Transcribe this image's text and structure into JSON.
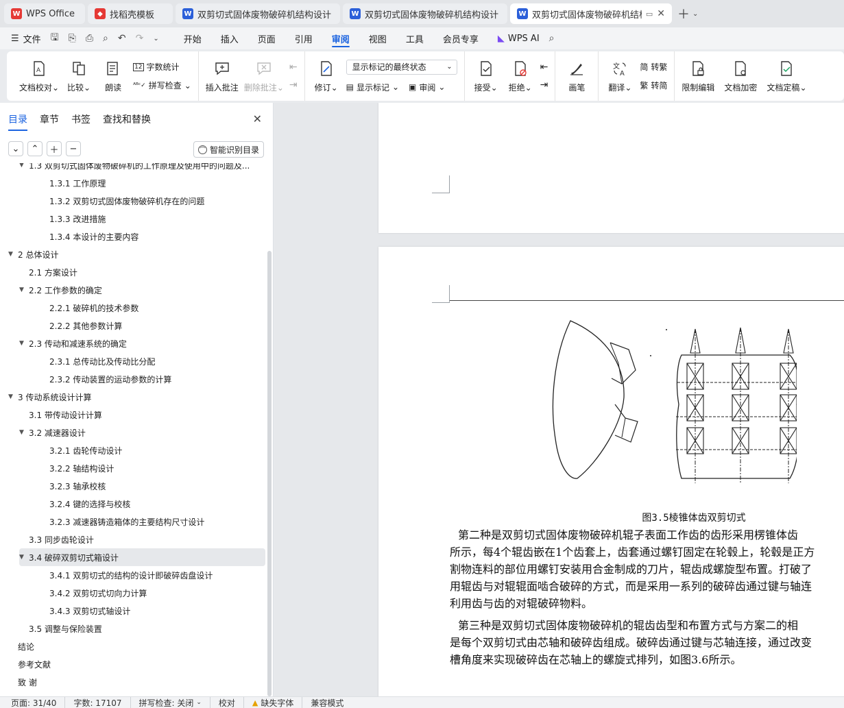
{
  "tabs": [
    {
      "label": "WPS Office",
      "icon": "wps-logo-icon",
      "color": "#e53935"
    },
    {
      "label": "找稻壳模板",
      "icon": "docer-icon",
      "color": "#e53935"
    },
    {
      "label": "双剪切式固体废物破碎机结构设计 任务",
      "icon": "word-doc-icon",
      "color": "#2b5fd9"
    },
    {
      "label": "双剪切式固体废物破碎机结构设计 开题",
      "icon": "word-doc-icon",
      "color": "#2b5fd9"
    },
    {
      "label": "双剪切式固体废物破碎机结构设",
      "icon": "word-doc-icon",
      "color": "#2b5fd9"
    }
  ],
  "menubar": {
    "file_label": "文件",
    "tabs": [
      "开始",
      "插入",
      "页面",
      "引用",
      "审阅",
      "视图",
      "工具",
      "会员专享"
    ],
    "active_tab": "审阅",
    "ai_label": "WPS AI"
  },
  "ribbon": {
    "proofread": "文档校对",
    "compare": "比较",
    "read_aloud": "朗读",
    "word_count": "字数统计",
    "spell_check": "拼写检查",
    "insert_comment": "插入批注",
    "delete_comment": "删除批注",
    "revise": "修订",
    "markup_state": "显示标记的最终状态",
    "show_markup": "显示标记",
    "review": "审阅",
    "accept": "接受",
    "reject": "拒绝",
    "pen": "画笔",
    "translate": "翻译",
    "to_traditional": "转繁",
    "to_simplified": "转简",
    "restrict_edit": "限制编辑",
    "encrypt": "文档加密",
    "finalize": "文档定稿"
  },
  "sidebar": {
    "tabs": [
      "目录",
      "章节",
      "书签",
      "查找和替换"
    ],
    "active_tab": "目录",
    "smart_toc": "智能识别目录",
    "toc": [
      {
        "level": 2,
        "caret": true,
        "text": "1.3 双剪切式固体废物破碎机的工作原理及使用中的问题及..."
      },
      {
        "level": 3,
        "caret": false,
        "text": "1.3.1 工作原理"
      },
      {
        "level": 3,
        "caret": false,
        "text": "1.3.2 双剪切式固体废物破碎机存在的问题"
      },
      {
        "level": 3,
        "caret": false,
        "text": "1.3.3 改进措施"
      },
      {
        "level": 3,
        "caret": false,
        "text": "1.3.4 本设计的主要内容"
      },
      {
        "level": 1,
        "caret": true,
        "text": "2  总体设计"
      },
      {
        "level": 2,
        "caret": false,
        "text": "2.1 方案设计"
      },
      {
        "level": 2,
        "caret": true,
        "text": "2.2 工作参数的确定"
      },
      {
        "level": 3,
        "caret": false,
        "text": "2.2.1 破碎机的技术参数"
      },
      {
        "level": 3,
        "caret": false,
        "text": "2.2.2 其他参数计算"
      },
      {
        "level": 2,
        "caret": true,
        "text": "2.3 传动和减速系统的确定"
      },
      {
        "level": 3,
        "caret": false,
        "text": "2.3.1 总传动比及传动比分配"
      },
      {
        "level": 3,
        "caret": false,
        "text": "2.3.2 传动装置的运动参数的计算"
      },
      {
        "level": 1,
        "caret": true,
        "text": "3  传动系统设计计算"
      },
      {
        "level": 2,
        "caret": false,
        "text": "3.1  带传动设计计算"
      },
      {
        "level": 2,
        "caret": true,
        "text": "3.2 减速器设计"
      },
      {
        "level": 3,
        "caret": false,
        "text": "3.2.1 齿轮传动设计"
      },
      {
        "level": 3,
        "caret": false,
        "text": "3.2.2 轴结构设计"
      },
      {
        "level": 3,
        "caret": false,
        "text": "3.2.3 轴承校核"
      },
      {
        "level": 3,
        "caret": false,
        "text": "3.2.4 键的选择与校核"
      },
      {
        "level": 3,
        "caret": false,
        "text": "3.2.3 减速器铸造箱体的主要结构尺寸设计"
      },
      {
        "level": 2,
        "caret": false,
        "text": "3.3 同步齿轮设计"
      },
      {
        "level": 2,
        "caret": true,
        "text": "3.4 破碎双剪切式箱设计",
        "selected": true
      },
      {
        "level": 3,
        "caret": false,
        "text": "3.4.1 双剪切式的结构的设计即破碎齿盘设计"
      },
      {
        "level": 3,
        "caret": false,
        "text": "3.4.2 双剪切式切向力计算"
      },
      {
        "level": 3,
        "caret": false,
        "text": "3.4.3 双剪切式轴设计"
      },
      {
        "level": 2,
        "caret": false,
        "text": "3.5 调整与保险装置"
      },
      {
        "level": 1,
        "caret": false,
        "text": "结论"
      },
      {
        "level": 1,
        "caret": false,
        "text": "参考文献"
      },
      {
        "level": 1,
        "caret": false,
        "text": "致   谢"
      }
    ]
  },
  "document": {
    "caption": "图3.5棱锥体齿双剪切式",
    "paragraph_lines": [
      "　　第二种是双剪切式固体废物破碎机辊子表面工作齿的齿形采用楞锥体齿",
      "所示，每4个辊齿嵌在1个齿套上，齿套通过螺钉固定在轮毂上，轮毂是正方",
      "割物连料的部位用螺钉安装用合金制成的刀片，辊齿成螺旋型布置。打破了",
      "用辊齿与对辊辊面啮合破碎的方式，而是采用一系列的破碎齿通过键与轴连",
      "利用齿与齿的对辊破碎物料。",
      "　　第三种是双剪切式固体废物破碎机的辊齿齿型和布置方式与方案二的相",
      "是每个双剪切式由芯轴和破碎齿组成。破碎齿通过键与芯轴连接，通过改变",
      "槽角度来实现破碎齿在芯轴上的螺旋式排列，如图3.6所示。"
    ]
  },
  "statusbar": {
    "page": "页面: 31/40",
    "words": "字数: 17107",
    "spell": "拼写检查: 关闭",
    "proof": "校对",
    "missing_font": "缺失字体",
    "compat": "兼容模式"
  }
}
